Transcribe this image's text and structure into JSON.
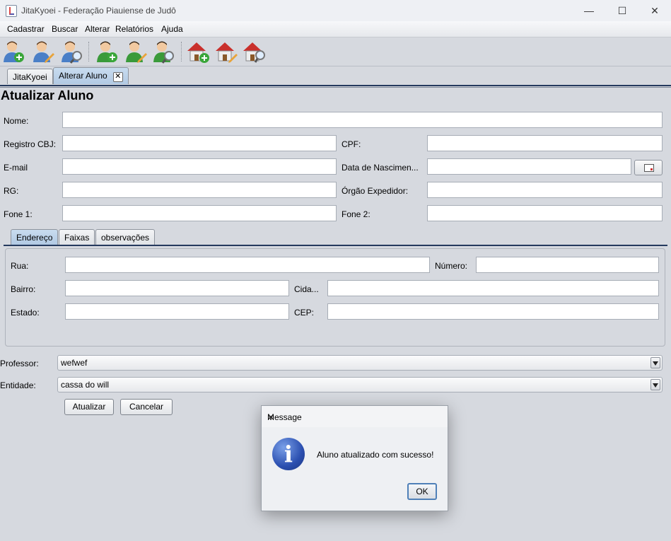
{
  "window": {
    "title": "JitaKyoei - Federação Piauiense de Judô",
    "controls": {
      "minimize": "—",
      "maximize": "☐",
      "close": "✕"
    }
  },
  "menu": [
    "Cadastrar",
    "Buscar",
    "Alterar",
    "Relatórios",
    "Ajuda"
  ],
  "toolbar": {
    "buttons": [
      "add-student-icon",
      "edit-student-icon",
      "search-student-icon",
      "add-teacher-icon",
      "edit-teacher-icon",
      "search-teacher-icon",
      "add-entity-icon",
      "edit-entity-icon",
      "search-entity-icon"
    ]
  },
  "tabs": [
    {
      "label": "JitaKyoei"
    },
    {
      "label": "Alterar Aluno",
      "close": "✕"
    }
  ],
  "form": {
    "heading": "Atualizar Aluno",
    "nome_label": "Nome:",
    "registro_label": "Registro CBJ:",
    "cpf_label": "CPF:",
    "email_label": "E-mail",
    "nascimento_label": "Data de Nascimen...",
    "rg_label": "RG:",
    "orgao_label": "Órgão Expedidor:",
    "fone1_label": "Fone 1:",
    "fone2_label": "Fone 2:"
  },
  "inner_tabs": [
    "Endereço",
    "Faixas",
    "observações"
  ],
  "endereco": {
    "rua_label": "Rua:",
    "numero_label": "Número:",
    "bairro_label": "Bairro:",
    "cidade_label": "Cida...",
    "estado_label": "Estado:",
    "cep_label": "CEP:"
  },
  "professor": {
    "label": "Professor:",
    "value": "wefwef"
  },
  "entidade": {
    "label": "Entidade:",
    "value": "cassa do will"
  },
  "buttons": {
    "update": "Atualizar",
    "cancel": "Cancelar"
  },
  "dialog": {
    "title": "Message",
    "close": "✕",
    "icon": "i",
    "message": "Aluno atualizado com sucesso!",
    "ok": "OK"
  },
  "colors": {
    "tab_active": "#b1c9e3",
    "tab_line": "#253a5e",
    "info_icon": "#2b4fb0"
  }
}
